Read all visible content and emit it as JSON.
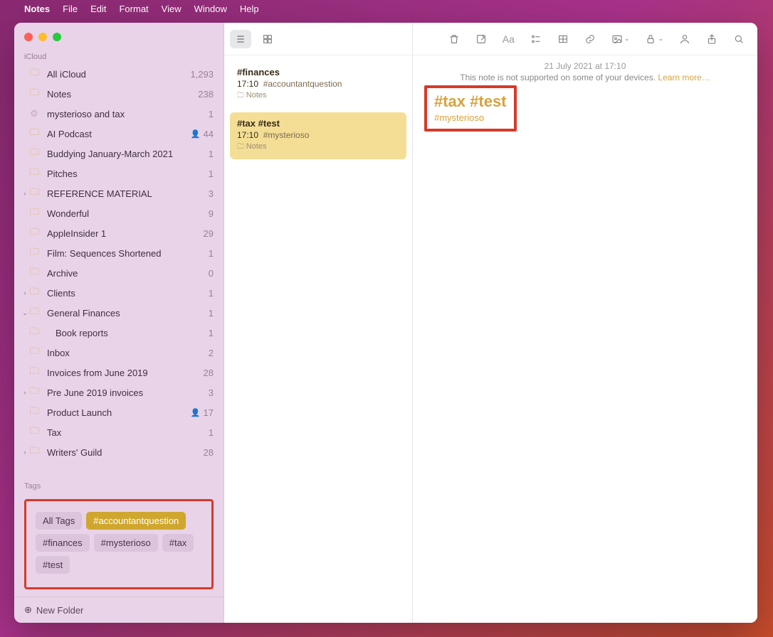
{
  "menubar": {
    "app": "Notes",
    "items": [
      "File",
      "Edit",
      "Format",
      "View",
      "Window",
      "Help"
    ]
  },
  "sidebar": {
    "section": "iCloud",
    "folders": [
      {
        "name": "All iCloud",
        "count": "1,293",
        "icon": "folder"
      },
      {
        "name": "Notes",
        "count": "238",
        "icon": "folder"
      },
      {
        "name": "mysterioso and tax",
        "count": "1",
        "icon": "gear"
      },
      {
        "name": "AI Podcast",
        "count": "44",
        "icon": "folder",
        "shared": true
      },
      {
        "name": "Buddying January-March 2021",
        "count": "1",
        "icon": "folder"
      },
      {
        "name": "Pitches",
        "count": "1",
        "icon": "folder"
      },
      {
        "name": "REFERENCE MATERIAL",
        "count": "3",
        "icon": "folder",
        "chevron": ">"
      },
      {
        "name": "Wonderful",
        "count": "9",
        "icon": "folder"
      },
      {
        "name": "AppleInsider 1",
        "count": "29",
        "icon": "folder"
      },
      {
        "name": "Film: Sequences Shortened",
        "count": "1",
        "icon": "folder"
      },
      {
        "name": "Archive",
        "count": "0",
        "icon": "folder"
      },
      {
        "name": "Clients",
        "count": "1",
        "icon": "folder",
        "chevron": ">"
      },
      {
        "name": "General Finances",
        "count": "1",
        "icon": "folder",
        "chevron": "v"
      },
      {
        "name": "Book reports",
        "count": "1",
        "icon": "folder",
        "child": true
      },
      {
        "name": "Inbox",
        "count": "2",
        "icon": "folder"
      },
      {
        "name": "Invoices from June 2019",
        "count": "28",
        "icon": "folder"
      },
      {
        "name": "Pre June 2019 invoices",
        "count": "3",
        "icon": "folder",
        "chevron": ">"
      },
      {
        "name": "Product Launch",
        "count": "17",
        "icon": "folder",
        "shared": true
      },
      {
        "name": "Tax",
        "count": "1",
        "icon": "folder"
      },
      {
        "name": "Writers' Guild",
        "count": "28",
        "icon": "folder",
        "chevron": ">"
      }
    ],
    "tags_label": "Tags",
    "tags": [
      {
        "label": "All Tags",
        "active": false
      },
      {
        "label": "#accountantquestion",
        "active": true
      },
      {
        "label": "#finances",
        "active": false
      },
      {
        "label": "#mysterioso",
        "active": false
      },
      {
        "label": "#tax",
        "active": false
      },
      {
        "label": "#test",
        "active": false
      }
    ],
    "newfolder": "New Folder"
  },
  "notelist": [
    {
      "title": "#finances",
      "time": "17:10",
      "snippet": "#accountantquestion",
      "location": "Notes",
      "selected": false
    },
    {
      "title": "#tax #test",
      "time": "17:10",
      "snippet": "#mysterioso",
      "location": "Notes",
      "selected": true
    }
  ],
  "note": {
    "date": "21 July 2021 at 17:10",
    "warn": "This note is not supported on some of your devices. ",
    "learn": "Learn more…",
    "title": "#tax #test",
    "sub": "#mysterioso"
  }
}
